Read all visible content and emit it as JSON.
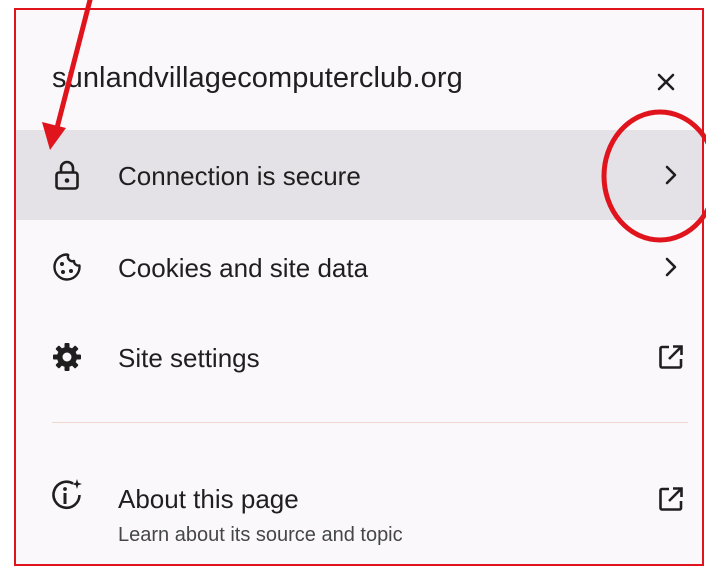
{
  "popup": {
    "site": "sunlandvillagecomputerclub.org",
    "close_icon": "close-icon"
  },
  "items": [
    {
      "label": "Connection is secure",
      "icon": "lock-icon",
      "trailing": "chevron-right-icon",
      "highlighted": true
    },
    {
      "label": "Cookies and site data",
      "icon": "cookie-icon",
      "trailing": "chevron-right-icon"
    },
    {
      "label": "Site settings",
      "icon": "gear-icon",
      "trailing": "open-external-icon"
    },
    {
      "label": "About this page",
      "sublabel": "Learn about its source and topic",
      "icon": "info-sparkle-icon",
      "trailing": "open-external-icon"
    }
  ],
  "colors": {
    "frame_border": "#e0141c",
    "annotation": "#e0141c",
    "highlight_bg": "#e4e2e6",
    "text": "#1f1f1f"
  }
}
